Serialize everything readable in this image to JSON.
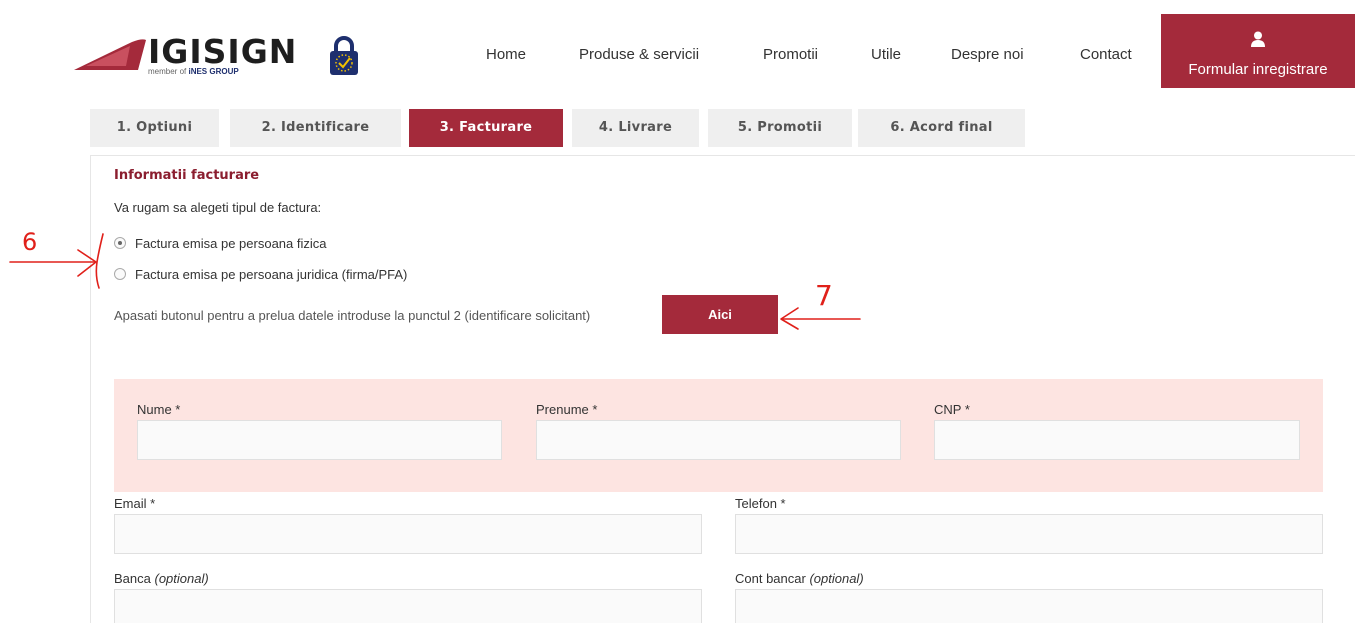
{
  "header": {
    "logo_text": "IGISIGN",
    "logo_sub_prefix": "member of ",
    "logo_sub_brand": "iNES GROUP",
    "nav": [
      "Home",
      "Produse & servicii",
      "Promotii",
      "Utile",
      "Despre noi",
      "Contact"
    ],
    "register_label": "Formular inregistrare"
  },
  "tabs": [
    "1. Optiuni",
    "2. Identificare",
    "3. Facturare",
    "4. Livrare",
    "5. Promotii",
    "6. Acord final"
  ],
  "active_tab": "3. Facturare",
  "billing": {
    "title": "Informatii facturare",
    "prompt": "Va rugam sa alegeti tipul de factura:",
    "options": [
      "Factura emisa pe persoana fizica",
      "Factura emisa pe persoana juridica (firma/PFA)"
    ],
    "selected_option": "Factura emisa pe persoana fizica",
    "fetch_text": "Apasati butonul pentru a prelua datele introduse la punctul 2 (identificare solicitant)",
    "fetch_button": "Aici"
  },
  "form": {
    "nume_label": "Nume *",
    "prenume_label": "Prenume *",
    "cnp_label": "CNP *",
    "email_label": "Email *",
    "telefon_label": "Telefon *",
    "banca_label": "Banca",
    "cont_label": "Cont bancar",
    "optional_note": "(optional)",
    "nume_value": "",
    "prenume_value": "",
    "cnp_value": "",
    "email_value": "",
    "telefon_value": "",
    "banca_value": "",
    "cont_value": ""
  },
  "annotations": {
    "label_6": "6",
    "label_7": "7",
    "color": "#e0201a"
  },
  "colors": {
    "brand": "#a42a3b",
    "title": "#8b1e2f",
    "pink_bg": "#fde4e1"
  }
}
